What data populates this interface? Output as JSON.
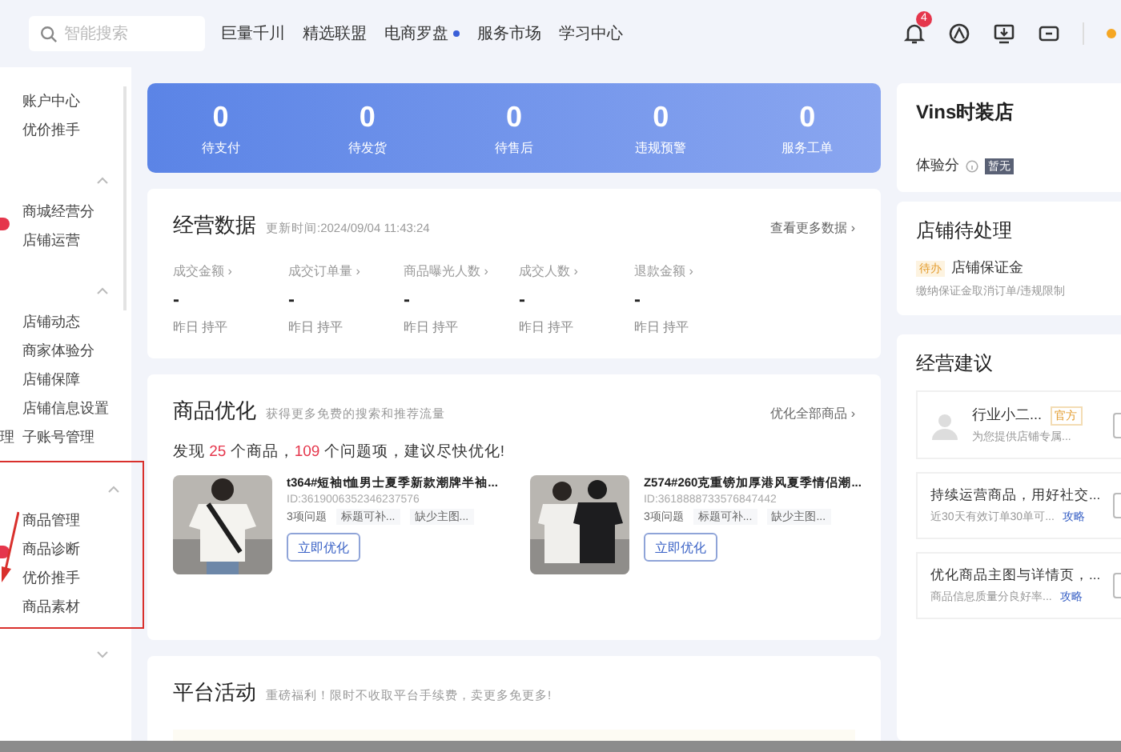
{
  "topbar": {
    "search": {
      "placeholder": "智能搜索"
    },
    "nav": [
      {
        "label": "巨量千川",
        "dot": false
      },
      {
        "label": "精选联盟",
        "dot": false
      },
      {
        "label": "电商罗盘",
        "dot": true
      },
      {
        "label": "服务市场",
        "dot": false
      },
      {
        "label": "学习中心",
        "dot": false
      }
    ],
    "notification_count": "4"
  },
  "sidebar": {
    "groups": [
      {
        "items": [
          "账户中心",
          "优价推手"
        ]
      },
      {
        "items": [
          "商城经营分",
          "店铺运营"
        ],
        "expanded": true,
        "badge": true
      },
      {
        "items": [
          "店铺动态",
          "商家体验分",
          "店铺保障",
          "店铺信息设置",
          "子账号管理"
        ],
        "expanded": true,
        "cut_label": "理"
      },
      {
        "items": [
          "商品管理",
          "商品诊断",
          "优价推手",
          "商品素材"
        ],
        "expanded": true,
        "badge": true,
        "highlighted": true
      },
      {
        "expanded": false
      }
    ]
  },
  "stats": [
    {
      "value": "0",
      "label": "待支付"
    },
    {
      "value": "0",
      "label": "待发货"
    },
    {
      "value": "0",
      "label": "待售后"
    },
    {
      "value": "0",
      "label": "违规预警"
    },
    {
      "value": "0",
      "label": "服务工单"
    }
  ],
  "business_data": {
    "title": "经营数据",
    "updated": "更新时间:2024/09/04 11:43:24",
    "link": "查看更多数据 ›",
    "metrics": [
      {
        "label": "成交金额 ›",
        "value": "-",
        "compare": "昨日 持平"
      },
      {
        "label": "成交订单量 ›",
        "value": "-",
        "compare": "昨日 持平"
      },
      {
        "label": "商品曝光人数 ›",
        "value": "-",
        "compare": "昨日 持平"
      },
      {
        "label": "成交人数 ›",
        "value": "-",
        "compare": "昨日 持平"
      },
      {
        "label": "退款金额 ›",
        "value": "-",
        "compare": "昨日 持平"
      }
    ]
  },
  "optimization": {
    "title": "商品优化",
    "subtitle": "获得更多免费的搜索和推荐流量",
    "link": "优化全部商品 ›",
    "summary": "发现 **25** 个商品，**109** 个问题项，建议尽快优化!",
    "products": [
      {
        "name": "t364#短袖t恤男士夏季新款潮牌半袖...",
        "id": "ID:3619006352346237576",
        "issues": "3项问题",
        "tags": [
          "标题可补...",
          "缺少主图..."
        ],
        "button": "立即优化"
      },
      {
        "name": "Z574#260克重镑加厚港风夏季情侣潮...",
        "id": "ID:3618888733576847442",
        "issues": "3项问题",
        "tags": [
          "标题可补...",
          "缺少主图..."
        ],
        "button": "立即优化"
      }
    ]
  },
  "activity": {
    "title": "平台活动",
    "subtitle": "重磅福利！限时不收取平台手续费，卖更多免更多!"
  },
  "shop": {
    "name": "Vins时装店",
    "score_label": "体验分",
    "score": "暂无"
  },
  "todo": {
    "title": "店铺待处理",
    "items": [
      {
        "tag": "待办",
        "title": "店铺保证金",
        "desc": "缴纳保证金取消订单/违规限制"
      }
    ]
  },
  "advice": {
    "title": "经营建议",
    "expert": {
      "name": "行业小二...",
      "badge": "官方",
      "desc": "为您提供店铺专属..."
    },
    "tips": [
      {
        "title": "持续运营商品，用好社交...",
        "desc": "近30天有效订单30单可...",
        "link": "攻略"
      },
      {
        "title": "优化商品主图与详情页，...",
        "desc": "商品信息质量分良好率...",
        "link": "攻略"
      }
    ]
  }
}
